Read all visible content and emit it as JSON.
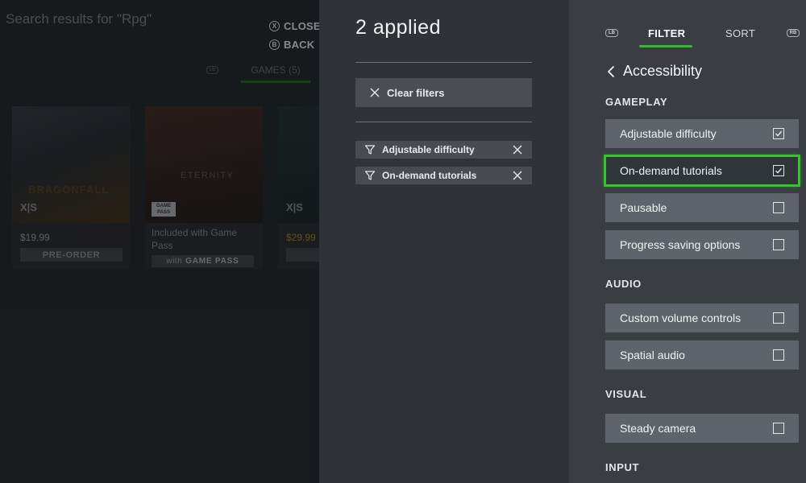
{
  "background": {
    "search_title": "Search results for \"Rpg\"",
    "hints": {
      "close": "CLOSE",
      "back": "BACK",
      "close_glyph": "X",
      "back_glyph": "B"
    },
    "tab_bumper": "LB",
    "games_tab": "GAMES (5)",
    "cards": [
      {
        "logo": "BRAGONFALL",
        "platform": "X|S",
        "price": "$19.99",
        "action": "PRE-ORDER"
      },
      {
        "logo": "ETERNITY",
        "badge_line1": "GAME",
        "badge_line2": "PASS",
        "note": "Included with Game Pass",
        "with_prefix": "with",
        "with_brand": "GAME PASS"
      },
      {
        "platform": "X|S",
        "price": "$29.99",
        "action": "PR"
      }
    ]
  },
  "applied": {
    "count_label": "2 applied",
    "clear_label": "Clear filters",
    "chips": [
      {
        "label": "Adjustable difficulty"
      },
      {
        "label": "On-demand tutorials"
      }
    ]
  },
  "filter_panel": {
    "tabs": {
      "lb": "LB",
      "filter": "FILTER",
      "sort": "SORT",
      "rb": "RB"
    },
    "heading": "Accessibility",
    "sections": {
      "gameplay": "GAMEPLAY",
      "audio": "AUDIO",
      "visual": "VISUAL",
      "input": "INPUT"
    },
    "options": [
      {
        "label": "Adjustable difficulty",
        "checked": true
      },
      {
        "label": "On-demand tutorials",
        "checked": true,
        "focused": true
      },
      {
        "label": "Pausable",
        "checked": false
      },
      {
        "label": "Progress saving options",
        "checked": false
      },
      {
        "label": "Custom volume controls",
        "checked": false
      },
      {
        "label": "Spatial audio",
        "checked": false
      },
      {
        "label": "Steady camera",
        "checked": false
      }
    ],
    "colors": {
      "accent": "#2fbf28",
      "option_bg": "#5f646c",
      "panel_bg": "#3a3e43"
    }
  }
}
